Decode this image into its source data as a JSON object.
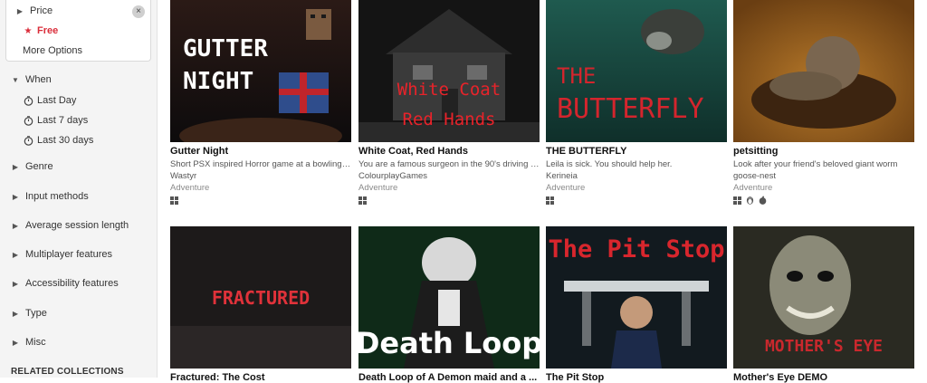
{
  "filters": {
    "price": {
      "title": "Price",
      "selected": "Free",
      "more": "More Options",
      "clear": "×"
    },
    "when": {
      "title": "When",
      "options": [
        "Last Day",
        "Last 7 days",
        "Last 30 days"
      ]
    },
    "collapsed": [
      "Genre",
      "Input methods",
      "Average session length",
      "Multiplayer features",
      "Accessibility features",
      "Type",
      "Misc"
    ],
    "related": "RELATED COLLECTIONS"
  },
  "games": [
    {
      "title": "Gutter Night",
      "desc": "Short PSX inspired Horror game at a bowling al...",
      "author": "Wastyr",
      "genre": "Adventure",
      "platforms": [
        "windows-icon"
      ],
      "art": [
        "GUTTER",
        "NIGHT"
      ]
    },
    {
      "title": "White Coat, Red Hands",
      "desc": "You are a famous surgeon in the 90's driving ho...",
      "author": "ColourplayGames",
      "genre": "Adventure",
      "platforms": [
        "windows-icon"
      ],
      "art": [
        "White Coat",
        "Red Hands"
      ]
    },
    {
      "title": "THE BUTTERFLY",
      "desc": "Leila is sick. You should help her.",
      "author": "Kerineia",
      "genre": "Adventure",
      "platforms": [
        "windows-icon"
      ],
      "art": [
        "THE",
        "BUTTERFLY"
      ]
    },
    {
      "title": "petsitting",
      "desc": "Look after your friend's beloved giant worm",
      "author": "goose-nest",
      "genre": "Adventure",
      "platforms": [
        "windows-icon",
        "linux-icon",
        "apple-icon"
      ],
      "art": []
    },
    {
      "title": "Fractured: The Cost",
      "desc": "",
      "author": "",
      "genre": "",
      "platforms": [],
      "art": [
        "FRACTURED"
      ]
    },
    {
      "title": "Death Loop of A Demon maid and a ...",
      "desc": "",
      "author": "",
      "genre": "",
      "platforms": [],
      "art": [
        "Death Loop"
      ]
    },
    {
      "title": "The Pit Stop",
      "desc": "",
      "author": "",
      "genre": "",
      "platforms": [],
      "art": [
        "The Pit Stop"
      ]
    },
    {
      "title": "Mother's Eye DEMO",
      "desc": "",
      "author": "",
      "genre": "",
      "platforms": [],
      "art": [
        "MOTHER'S EYE"
      ]
    }
  ]
}
